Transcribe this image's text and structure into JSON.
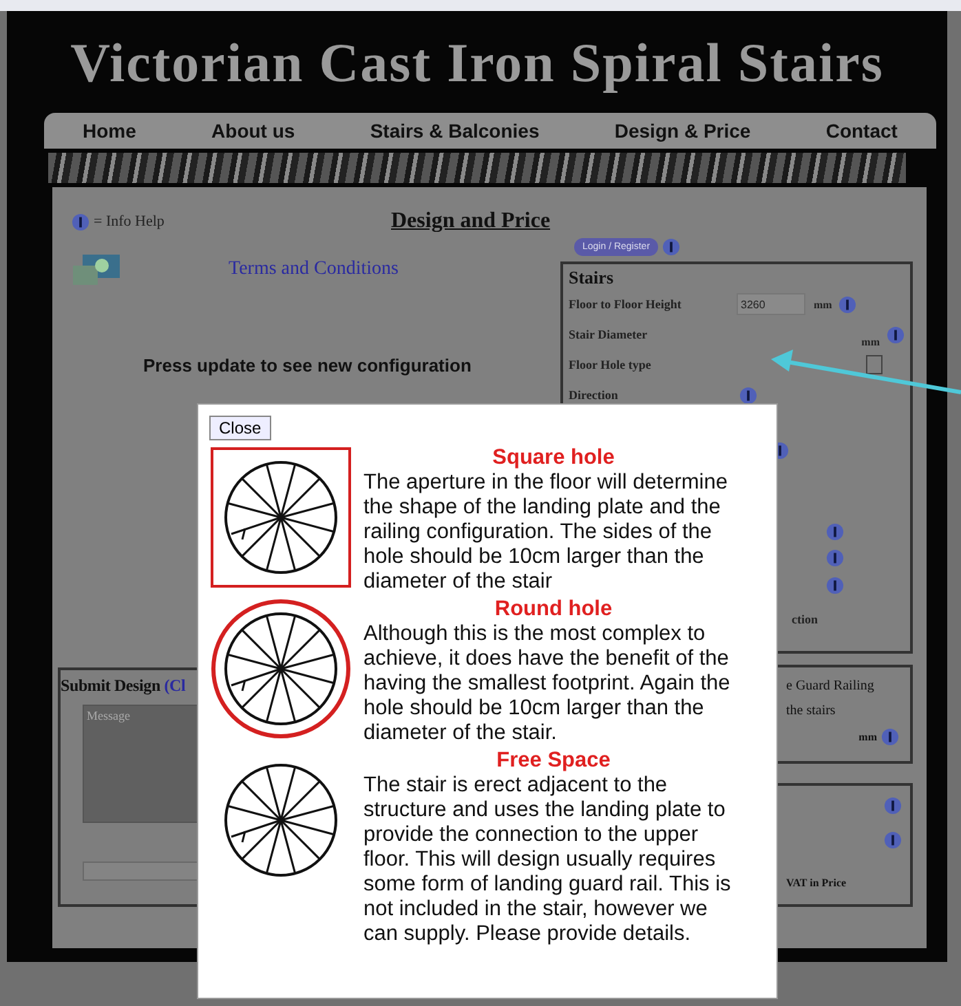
{
  "header": {
    "title": "Victorian Cast Iron Spiral Stairs"
  },
  "nav": [
    {
      "label": "Home"
    },
    {
      "label": "About us"
    },
    {
      "label": "Stairs & Balconies"
    },
    {
      "label": "Design & Price"
    },
    {
      "label": "Contact"
    }
  ],
  "page_title": "Design and Price",
  "info_help": "= Info Help",
  "terms_link": "Terms and Conditions",
  "update_note": "Press update to see new configuration",
  "login_button": "Login / Register",
  "stairs_box": {
    "title": "Stairs",
    "rows": [
      {
        "kind": "input",
        "label": "Floor to Floor Height",
        "value": "3260",
        "unit": "mm"
      },
      {
        "kind": "unit",
        "label": "Stair Diameter",
        "unit": "mm"
      },
      {
        "kind": "box",
        "label": "Floor Hole type"
      },
      {
        "kind": "info",
        "label": "Direction"
      }
    ],
    "partial_label": "ction"
  },
  "guard_box": {
    "lines": [
      "e Guard Railing",
      "the stairs"
    ],
    "unit": "mm"
  },
  "price_box": {
    "note": "VAT in Price"
  },
  "submit_box": {
    "title": "Submit Design",
    "link": "(Cl",
    "placeholder": "Message"
  },
  "modal": {
    "close": "Close",
    "options": [
      {
        "kind": "square",
        "title": "Square hole",
        "text": "The aperture in the floor will determine the shape of the landing plate and the railing configuration. The sides of the hole should be 10cm larger than the diameter of the stair"
      },
      {
        "kind": "round",
        "title": "Round hole",
        "text": "Although this is the most complex to achieve, it does have the benefit of the having the smallest footprint. Again the hole should be 10cm larger than the diameter of the stair."
      },
      {
        "kind": "free",
        "title": "Free Space",
        "text": "The stair is erect adjacent to the structure and uses the landing plate to provide the connection to the upper floor. This will design usually requires some form of landing guard rail. This is not included in the stair, however we can supply. Please provide details."
      }
    ]
  }
}
